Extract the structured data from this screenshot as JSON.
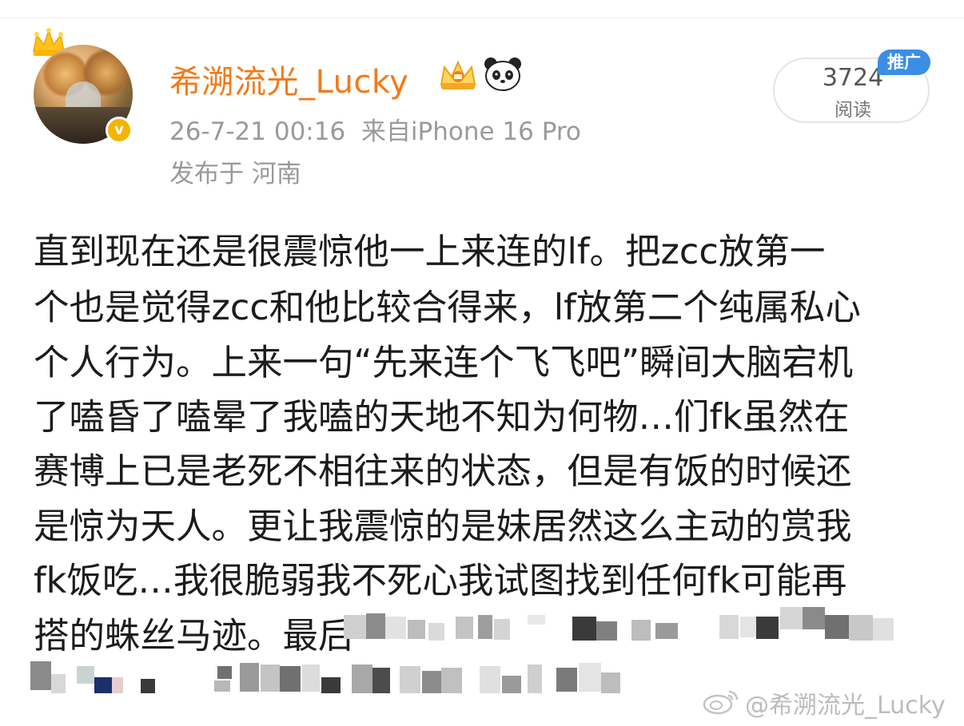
{
  "post": {
    "username": "希溯流光_Lucky",
    "timestamp": "26-7-21 00:16",
    "source": "来自iPhone 16 Pro",
    "location": "发布于 河南",
    "reads_count": "3724",
    "reads_label": "阅读",
    "promo_tag": "推广",
    "lines": [
      "直到现在还是很震惊他一上来连的lf。把zcc放第一",
      "个也是觉得zcc和他比较合得来，lf放第二个纯属私心",
      "个人行为。上来一句“先来连个飞飞吧”瞬间大脑宕机",
      "了嗑昏了嗑晕了我嗑的天地不知为何物…们fk虽然在",
      "赛博上已是老死不相往来的状态，但是有饭的时候还",
      "是惊为天人。更让我震惊的是妹居然这么主动的赏我",
      " fk饭吃…我很脆弱我不死心我试图找到任何fk可能再",
      "搭的蛛丝马迹。最后"
    ]
  },
  "watermark": "@希溯流光_Lucky",
  "icons": {
    "crown": "crown-icon",
    "verified": "verified-badge-icon",
    "vip": "vip-crown-badge-icon",
    "panda": "panda-icon",
    "weibo": "weibo-logo-icon"
  },
  "colors": {
    "username": "#f27a1a",
    "meta": "#9a9a9a",
    "promo": "#3b8ee6",
    "verified": "#f5b400"
  }
}
